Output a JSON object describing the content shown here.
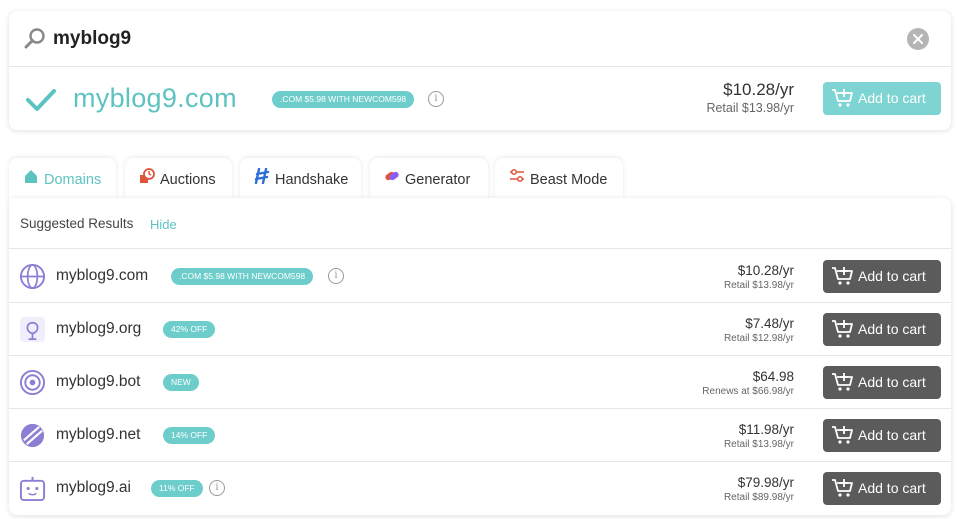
{
  "search": {
    "value": "myblog9",
    "placeholder": ""
  },
  "featured": {
    "domain": "myblog9.com",
    "promo": ".COM $5.98 WITH NEWCOM598",
    "price": "$10.28/yr",
    "retail": "Retail $13.98/yr",
    "cart_label": "Add to cart"
  },
  "tabs": [
    {
      "label": "Domains",
      "icon": "home-icon",
      "active": true
    },
    {
      "label": "Auctions",
      "icon": "auction-clock-icon",
      "active": false
    },
    {
      "label": "Handshake",
      "icon": "handshake-icon",
      "active": false
    },
    {
      "label": "Generator",
      "icon": "generator-icon",
      "active": false
    },
    {
      "label": "Beast Mode",
      "icon": "sliders-icon",
      "active": false
    }
  ],
  "suggestions": {
    "title": "Suggested Results",
    "hide_label": "Hide",
    "rows": [
      {
        "domain": "myblog9.com",
        "badge": ".COM $5.98 WITH NEWCOM598",
        "price": "$10.28/yr",
        "retail": "Retail $13.98/yr",
        "cart_label": "Add to cart",
        "icon": "globe-icon"
      },
      {
        "domain": "myblog9.org",
        "badge": "42% OFF",
        "price": "$7.48/yr",
        "retail": "Retail $12.98/yr",
        "cart_label": "Add to cart",
        "icon": "org-icon"
      },
      {
        "domain": "myblog9.bot",
        "badge": "NEW",
        "price": "$64.98",
        "retail": "Renews at $66.98/yr",
        "cart_label": "Add to cart",
        "icon": "target-icon"
      },
      {
        "domain": "myblog9.net",
        "badge": "14% OFF",
        "price": "$11.98/yr",
        "retail": "Retail $13.98/yr",
        "cart_label": "Add to cart",
        "icon": "net-icon"
      },
      {
        "domain": "myblog9.ai",
        "badge": "11% OFF",
        "price": "$79.98/yr",
        "retail": "Retail $89.98/yr",
        "cart_label": "Add to cart",
        "icon": "robot-icon"
      }
    ]
  },
  "colors": {
    "accent": "#5dc3c1",
    "badge": "#6dcdcb",
    "cart_primary": "#7ed4d2",
    "cart_dark": "#5b5b5b"
  }
}
